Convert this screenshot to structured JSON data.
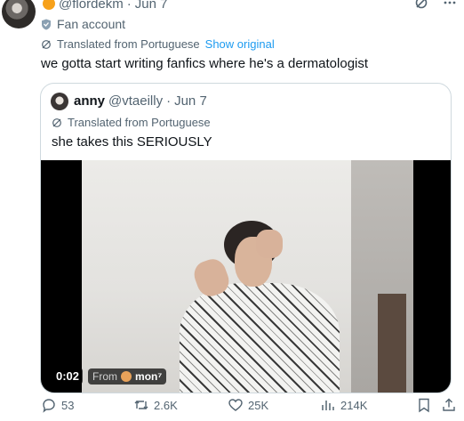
{
  "tweet": {
    "handle": "@flordekm",
    "sep": "·",
    "date": "Jun 7",
    "badge_label": "Fan account",
    "translated_label": "Translated from Portuguese",
    "show_original": "Show original",
    "text": "we gotta start writing fanfics where he's a dermatologist"
  },
  "quote": {
    "name": "anny",
    "handle": "@vtaeilly",
    "sep": "·",
    "date": "Jun 7",
    "translated_label": "Translated from Portuguese",
    "text": "she takes this SERIOUSLY",
    "video": {
      "time": "0:02",
      "from_label": "From",
      "from_name": "mon⁷"
    }
  },
  "actions": {
    "replies": "53",
    "reposts": "2.6K",
    "likes": "25K",
    "views": "214K"
  },
  "icons": {
    "more": "more-icon",
    "grok": "grok-icon",
    "translate": "translate-icon",
    "shield": "shield-icon",
    "reply": "reply-icon",
    "repost": "repost-icon",
    "like": "heart-icon",
    "views": "views-icon",
    "bookmark": "bookmark-icon",
    "share": "share-icon"
  },
  "colors": {
    "link": "#1d9bf0",
    "muted": "#536471",
    "text": "#0f1419",
    "border": "#cfd9de"
  }
}
